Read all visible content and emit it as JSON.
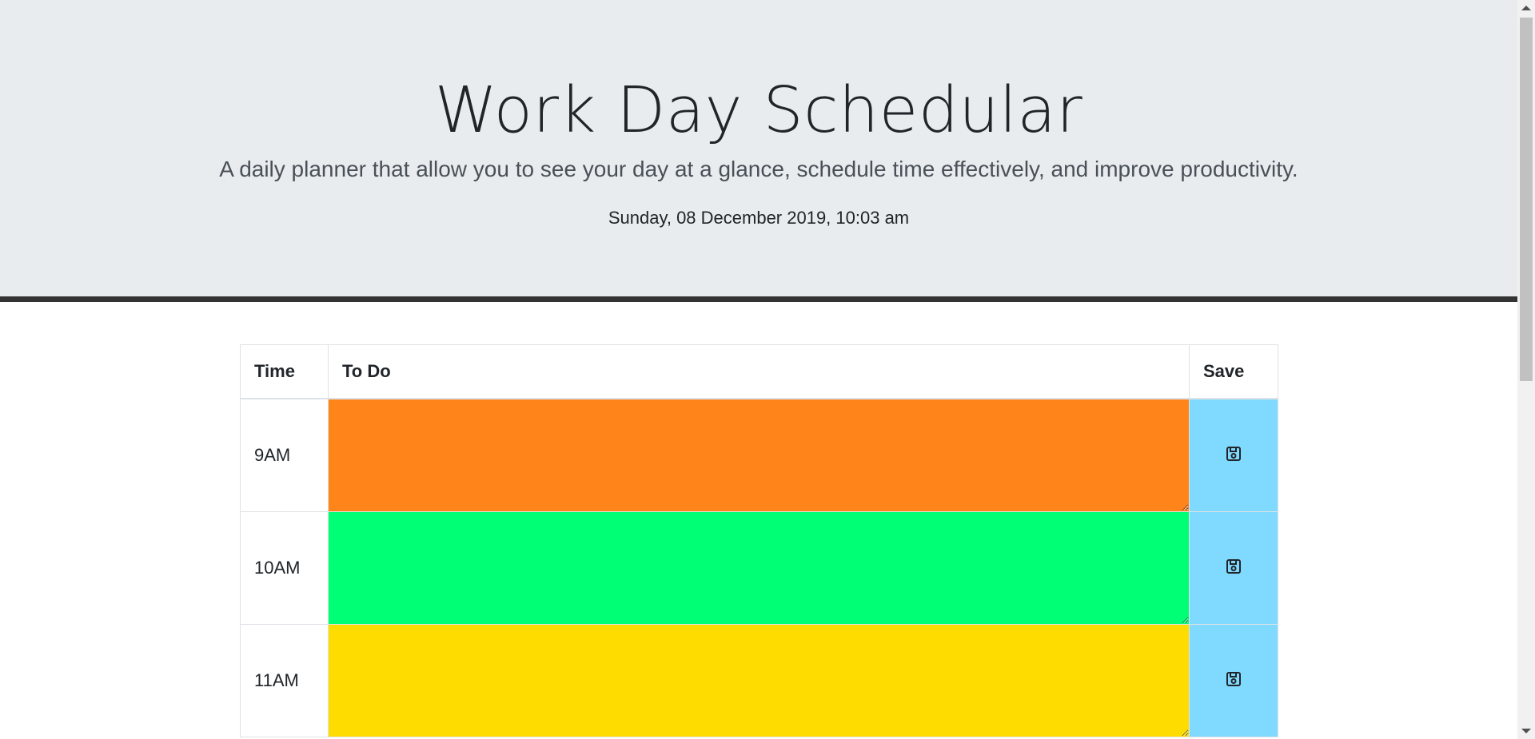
{
  "header": {
    "title": "Work Day Schedular",
    "subtitle": "A daily planner that allow you to see your day at a glance, schedule time effectively, and improve productivity.",
    "current_date": "Sunday, 08 December 2019, 10:03 am"
  },
  "table": {
    "columns": [
      "Time",
      "To Do",
      "Save"
    ],
    "rows": [
      {
        "time": "9AM",
        "todo": "",
        "status": "past",
        "color": "#ff851b"
      },
      {
        "time": "10AM",
        "todo": "",
        "status": "present",
        "color": "#00ff75"
      },
      {
        "time": "11AM",
        "todo": "",
        "status": "future",
        "color": "#ffdc00"
      }
    ],
    "save_icon": "floppy-disk-icon",
    "save_color": "#80d9ff"
  },
  "colors": {
    "header_background": "#e9ecef",
    "header_border": "#333333"
  }
}
